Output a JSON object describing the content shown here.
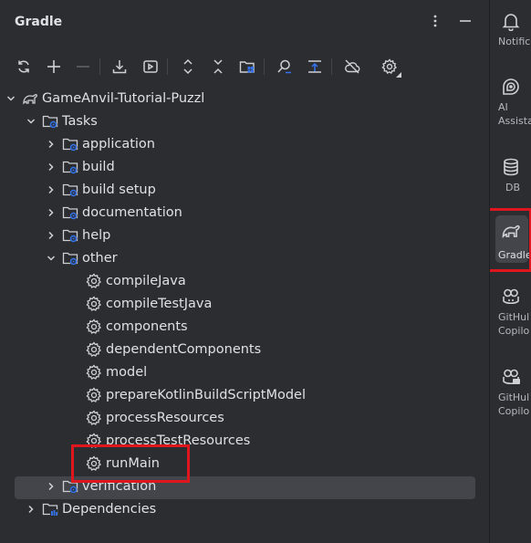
{
  "panel": {
    "title": "Gradle",
    "more_icon": "more-vertical-icon",
    "minimize_icon": "minimize-icon"
  },
  "toolbar": [
    {
      "name": "reload-icon"
    },
    {
      "name": "add-icon"
    },
    {
      "name": "remove-icon"
    },
    {
      "name": "download-sources-icon"
    },
    {
      "name": "run-task-icon"
    },
    {
      "name": "expand-all-icon"
    },
    {
      "name": "collapse-all-icon"
    },
    {
      "name": "group-modules-icon"
    },
    {
      "name": "analyze-dependencies-icon"
    },
    {
      "name": "build-script-icon"
    },
    {
      "name": "offline-mode-icon"
    },
    {
      "name": "settings-icon"
    }
  ],
  "tree": {
    "root": "GameAnvil-Tutorial-Puzzl",
    "tasks_label": "Tasks",
    "task_groups": [
      "application",
      "build",
      "build setup",
      "documentation",
      "help",
      "other"
    ],
    "other_tasks": [
      "compileJava",
      "compileTestJava",
      "components",
      "dependentComponents",
      "model",
      "prepareKotlinBuildScriptModel",
      "processResources",
      "processTestResources",
      "runMain"
    ],
    "verification_label": "verification",
    "dependencies_label": "Dependencies",
    "selected_task": "runMain"
  },
  "sidebar": {
    "notifications": "Notific",
    "ai_line1": "AI",
    "ai_line2": "Assista",
    "db": "DB",
    "gradle": "Gradle",
    "copilot1_line1": "GitHul",
    "copilot1_line2": "Copilo",
    "copilot2_line1": "GitHul",
    "copilot2_line2": "Copilo"
  },
  "colors": {
    "background": "#2b2d30",
    "selection": "#43454a",
    "highlight_box": "#e0161f",
    "gear_badge": "#3574f0"
  }
}
